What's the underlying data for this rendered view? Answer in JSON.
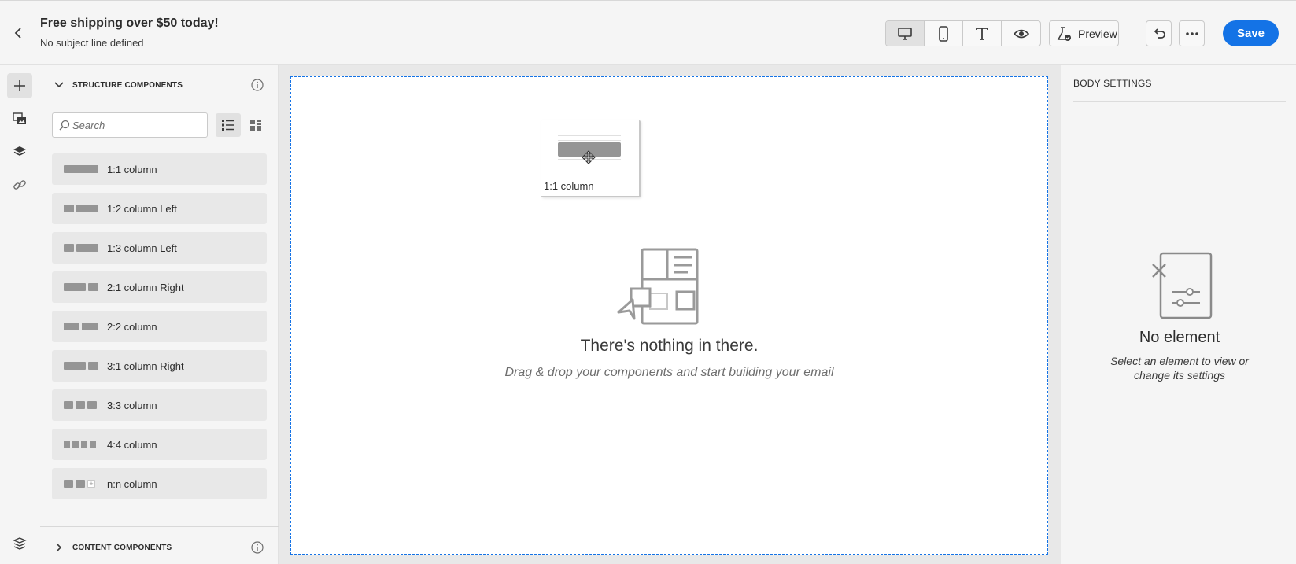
{
  "header": {
    "title": "Free shipping over $50 today!",
    "subtitle": "No subject line defined",
    "preview_label": "Preview",
    "save_label": "Save"
  },
  "components": {
    "structure_header": "STRUCTURE COMPONENTS",
    "content_header": "CONTENT COMPONENTS",
    "search_placeholder": "Search",
    "items": [
      {
        "label": "1:1 column"
      },
      {
        "label": "1:2 column Left"
      },
      {
        "label": "1:3 column Left"
      },
      {
        "label": "2:1 column Right"
      },
      {
        "label": "2:2 column"
      },
      {
        "label": "3:1 column Right"
      },
      {
        "label": "3:3 column"
      },
      {
        "label": "4:4 column"
      },
      {
        "label": "n:n column"
      }
    ]
  },
  "canvas": {
    "drag_label": "1:1 column",
    "empty_title": "There's nothing in there.",
    "empty_subtitle": "Drag & drop your components and start building your email"
  },
  "settings": {
    "title": "BODY SETTINGS",
    "empty_title": "No element",
    "empty_subtitle": "Select an element to view or change its settings"
  },
  "colors": {
    "accent": "#1473e6",
    "panel_bg": "#f5f5f5",
    "item_bg": "#e8e8e8"
  }
}
